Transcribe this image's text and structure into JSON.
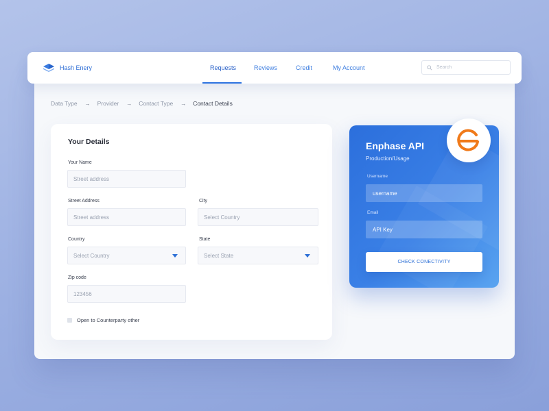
{
  "brand": {
    "name": "Hash Enery",
    "logo_icon": "stack-layers-icon",
    "color": "#2f6fd6"
  },
  "nav": {
    "items": [
      {
        "label": "Requests",
        "active": true
      },
      {
        "label": "Reviews",
        "active": false
      },
      {
        "label": "Credit",
        "active": false
      },
      {
        "label": "My Account",
        "active": false
      }
    ]
  },
  "search": {
    "placeholder": "Search",
    "icon": "search-icon"
  },
  "breadcrumb": {
    "items": [
      "Data Type",
      "Provider",
      "Contact Type",
      "Contact Details"
    ],
    "separator_icon": "arrow-right-icon"
  },
  "details_form": {
    "title": "Your Details",
    "your_name": {
      "label": "Your Name",
      "placeholder": "Street address"
    },
    "street_address": {
      "label": "Street Address",
      "placeholder": "Street address"
    },
    "city": {
      "label": "City",
      "placeholder": "Select Country"
    },
    "country": {
      "label": "Country",
      "value": "Select Country"
    },
    "state": {
      "label": "State",
      "value": "Select State"
    },
    "zip": {
      "label": "Zip code",
      "placeholder": "123456"
    },
    "checkbox_label": "Open to Counterparty other"
  },
  "api_card": {
    "title": "Enphase API",
    "subtitle": "Production/Usage",
    "username_label": "Username",
    "username_placeholder": "username",
    "email_label": "Email",
    "email_placeholder": "API Key",
    "button_label": "CHECK CONECTIVITY",
    "logo_icon": "enphase-logo-icon",
    "accent_color": "#2c6fdc",
    "logo_color": "#f07a1a"
  }
}
